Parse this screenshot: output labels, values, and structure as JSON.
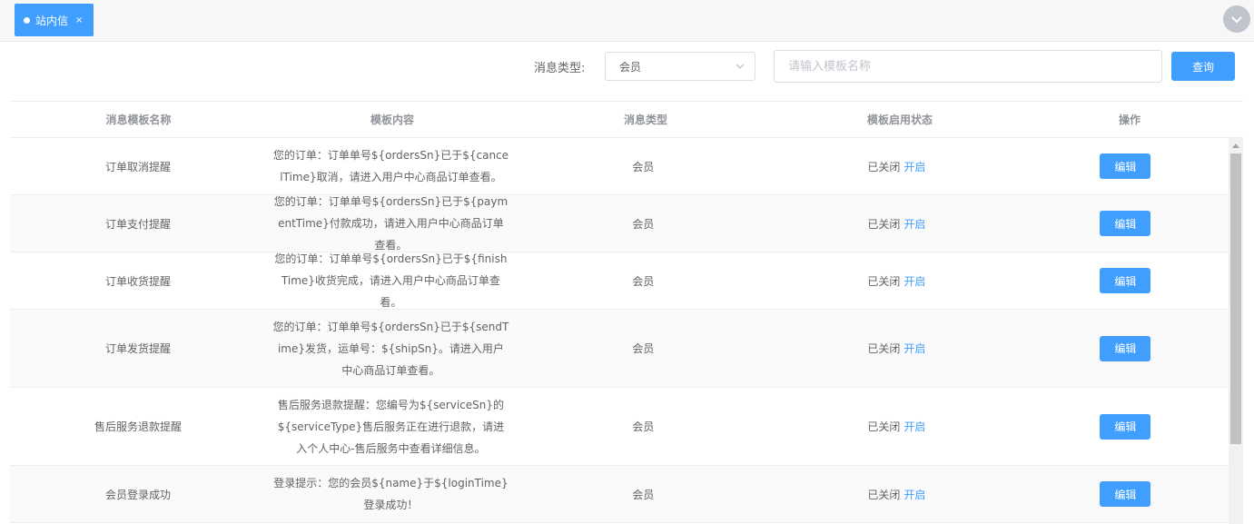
{
  "tab": {
    "label": "站内信",
    "close": "×"
  },
  "filters": {
    "type_label": "消息类型:",
    "type_value": "会员",
    "search_placeholder": "请输入模板名称",
    "query_label": "查询"
  },
  "table": {
    "headers": [
      "消息模板名称",
      "模板内容",
      "消息类型",
      "模板启用状态",
      "操作"
    ],
    "rows": [
      {
        "name": "订单取消提醒",
        "content": "您的订单：订单单号${ordersSn}已于${cancelTime}取消，请进入用户中心商品订单查看。",
        "type": "会员",
        "status": "已关闭",
        "action_toggle": "开启",
        "action_edit": "编辑"
      },
      {
        "name": "订单支付提醒",
        "content": "您的订单：订单单号${ordersSn}已于${paymentTime}付款成功，请进入用户中心商品订单查看。",
        "type": "会员",
        "status": "已关闭",
        "action_toggle": "开启",
        "action_edit": "编辑"
      },
      {
        "name": "订单收货提醒",
        "content": "您的订单：订单单号${ordersSn}已于${finishTime}收货完成，请进入用户中心商品订单查看。",
        "type": "会员",
        "status": "已关闭",
        "action_toggle": "开启",
        "action_edit": "编辑"
      },
      {
        "name": "订单发货提醒",
        "content": "您的订单：订单单号${ordersSn}已于${sendTime}发货，运单号：${shipSn}。请进入用户中心商品订单查看。",
        "type": "会员",
        "status": "已关闭",
        "action_toggle": "开启",
        "action_edit": "编辑"
      },
      {
        "name": "售后服务退款提醒",
        "content": "售后服务退款提醒：您编号为${serviceSn}的${serviceType}售后服务正在进行退款，请进入个人中心-售后服务中查看详细信息。",
        "type": "会员",
        "status": "已关闭",
        "action_toggle": "开启",
        "action_edit": "编辑"
      },
      {
        "name": "会员登录成功",
        "content": "登录提示：您的会员${name}于${loginTime}登录成功！",
        "type": "会员",
        "status": "已关闭",
        "action_toggle": "开启",
        "action_edit": "编辑"
      }
    ]
  },
  "colors": {
    "accent": "#409eff",
    "header_text": "#909399",
    "body_text": "#606266",
    "stripe": "#fafafa"
  }
}
